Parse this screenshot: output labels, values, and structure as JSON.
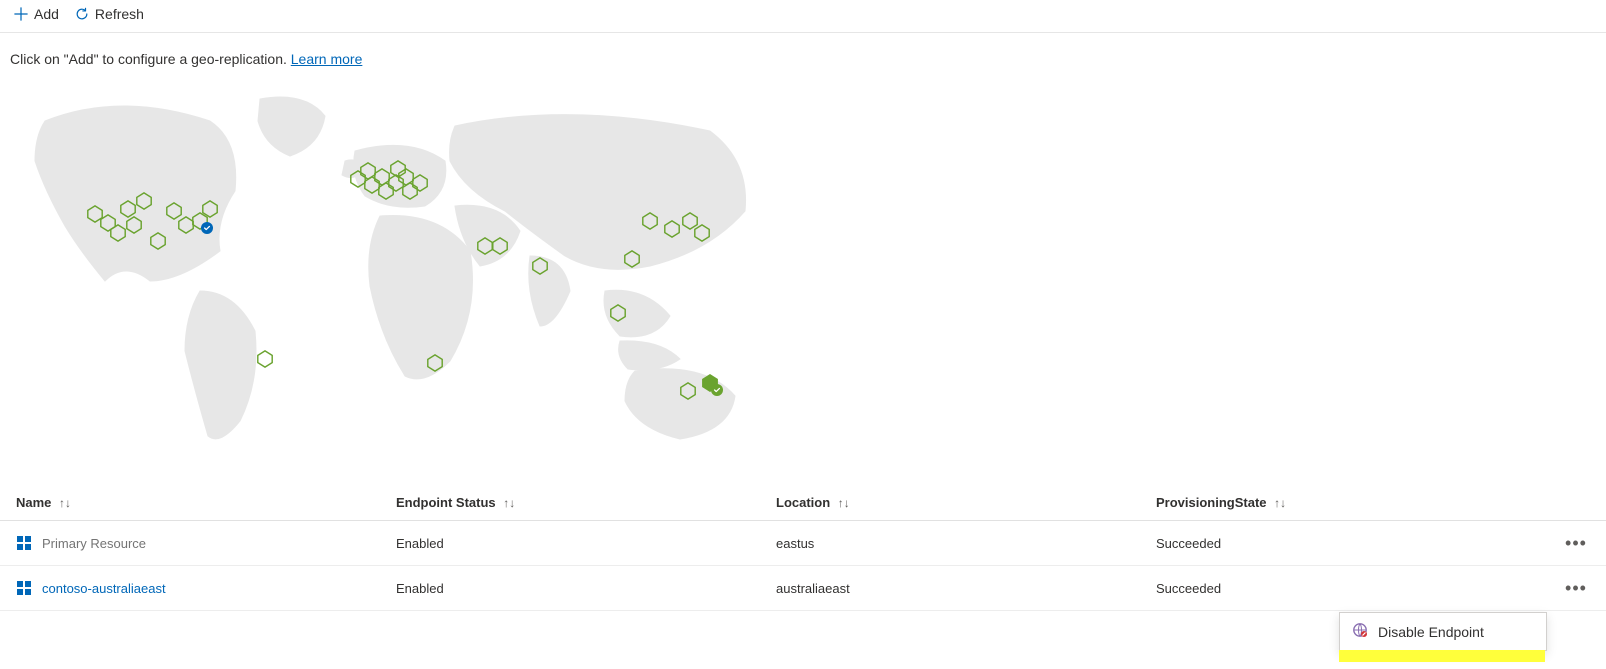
{
  "toolbar": {
    "add_label": "Add",
    "refresh_label": "Refresh"
  },
  "hint": {
    "text": "Click on \"Add\" to configure a geo-replication.",
    "link_label": "Learn more"
  },
  "columns": {
    "name": "Name",
    "endpoint_status": "Endpoint Status",
    "location": "Location",
    "provisioning_state": "ProvisioningState"
  },
  "rows": [
    {
      "name": "Primary Resource",
      "is_link": false,
      "endpoint_status": "Enabled",
      "location": "eastus",
      "provisioning_state": "Succeeded"
    },
    {
      "name": "contoso-australiaeast",
      "is_link": true,
      "endpoint_status": "Enabled",
      "location": "australiaeast",
      "provisioning_state": "Succeeded"
    }
  ],
  "context_menu": {
    "disable_label": "Disable Endpoint"
  },
  "map": {
    "primary_region": "eastus",
    "replica_region": "australiaeast"
  }
}
